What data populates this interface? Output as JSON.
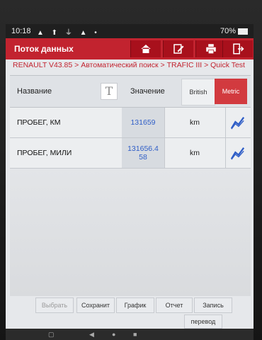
{
  "status": {
    "time": "10:18",
    "indicators": "▲ ⬆ ⏚ ▲ •",
    "battery": "70%"
  },
  "header": {
    "title": "Поток данных"
  },
  "breadcrumb": "RENAULT V43.85 > Автоматический поиск > TRAFIC III > Quick Test",
  "columns": {
    "name": "Название",
    "value": "Значение",
    "text_icon": "T"
  },
  "units_toggle": {
    "british": "British",
    "metric": "Metric",
    "selected": "Metric"
  },
  "rows": [
    {
      "name": "ПРОБЕГ, КМ",
      "value": "131659",
      "unit": "km"
    },
    {
      "name": "ПРОБЕГ, МИЛИ",
      "value": "131656.4\n58",
      "unit": "km"
    }
  ],
  "footer": {
    "select": "Выбрать",
    "save": "Сохранит",
    "graph": "График",
    "report": "Отчет",
    "record": "Запись",
    "translate": "перевод"
  },
  "colors": {
    "accent": "#c2232f",
    "value_text": "#2f5ec7"
  }
}
